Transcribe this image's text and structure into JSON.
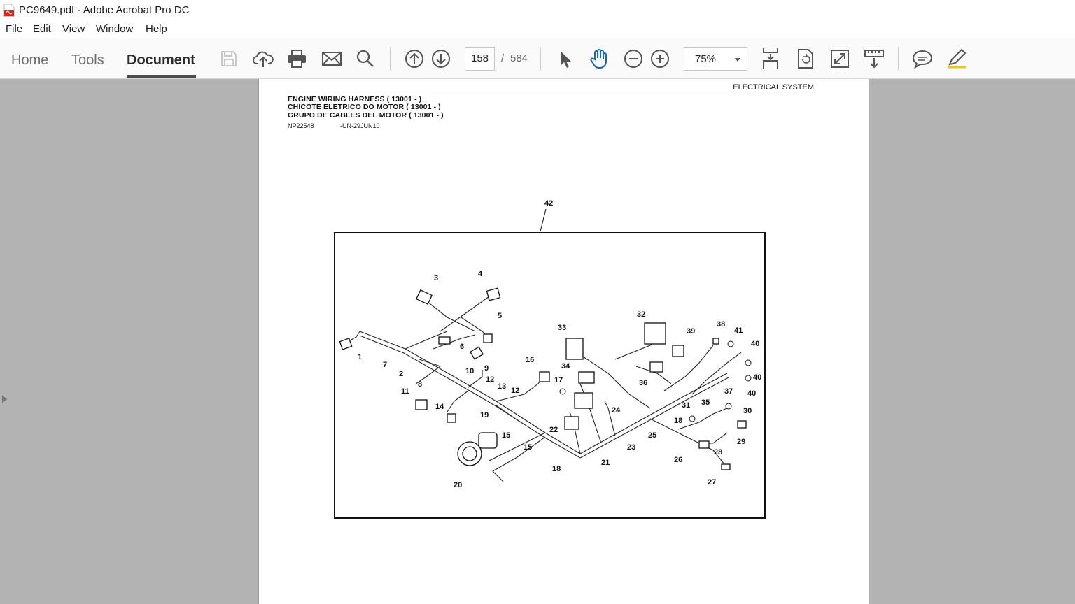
{
  "window": {
    "title": "PC9649.pdf - Adobe Acrobat Pro DC"
  },
  "menu": {
    "file": "File",
    "edit": "Edit",
    "view": "View",
    "window": "Window",
    "help": "Help"
  },
  "nav_tabs": {
    "home": "Home",
    "tools": "Tools",
    "document": "Document"
  },
  "pagination": {
    "current": "158",
    "separator": "/",
    "total": "584"
  },
  "zoom": {
    "value": "75%"
  },
  "document": {
    "section_header": "ELECTRICAL SYSTEM",
    "titles": [
      "ENGINE WIRING HARNESS ( 13001 - )",
      "CHICOTE ELETRICO DO MOTOR ( 13001 - )",
      "GRUPO DE CABLES DEL MOTOR ( 13001 - )"
    ],
    "figure_id": "NP22548",
    "figure_code": "-UN-29JUN10",
    "callout_top": "42",
    "callouts": [
      "1",
      "2",
      "3",
      "4",
      "5",
      "6",
      "7",
      "8",
      "9",
      "10",
      "11",
      "12",
      "12",
      "13",
      "14",
      "15",
      "15",
      "16",
      "17",
      "18",
      "18",
      "19",
      "20",
      "21",
      "22",
      "23",
      "24",
      "25",
      "26",
      "27",
      "28",
      "29",
      "30",
      "31",
      "32",
      "33",
      "34",
      "35",
      "36",
      "37",
      "38",
      "39",
      "40",
      "40",
      "40",
      "41"
    ]
  },
  "colors": {
    "accent": "#2c2c2c",
    "workspace": "#b3b3b3",
    "pdf_red": "#d9241b"
  }
}
